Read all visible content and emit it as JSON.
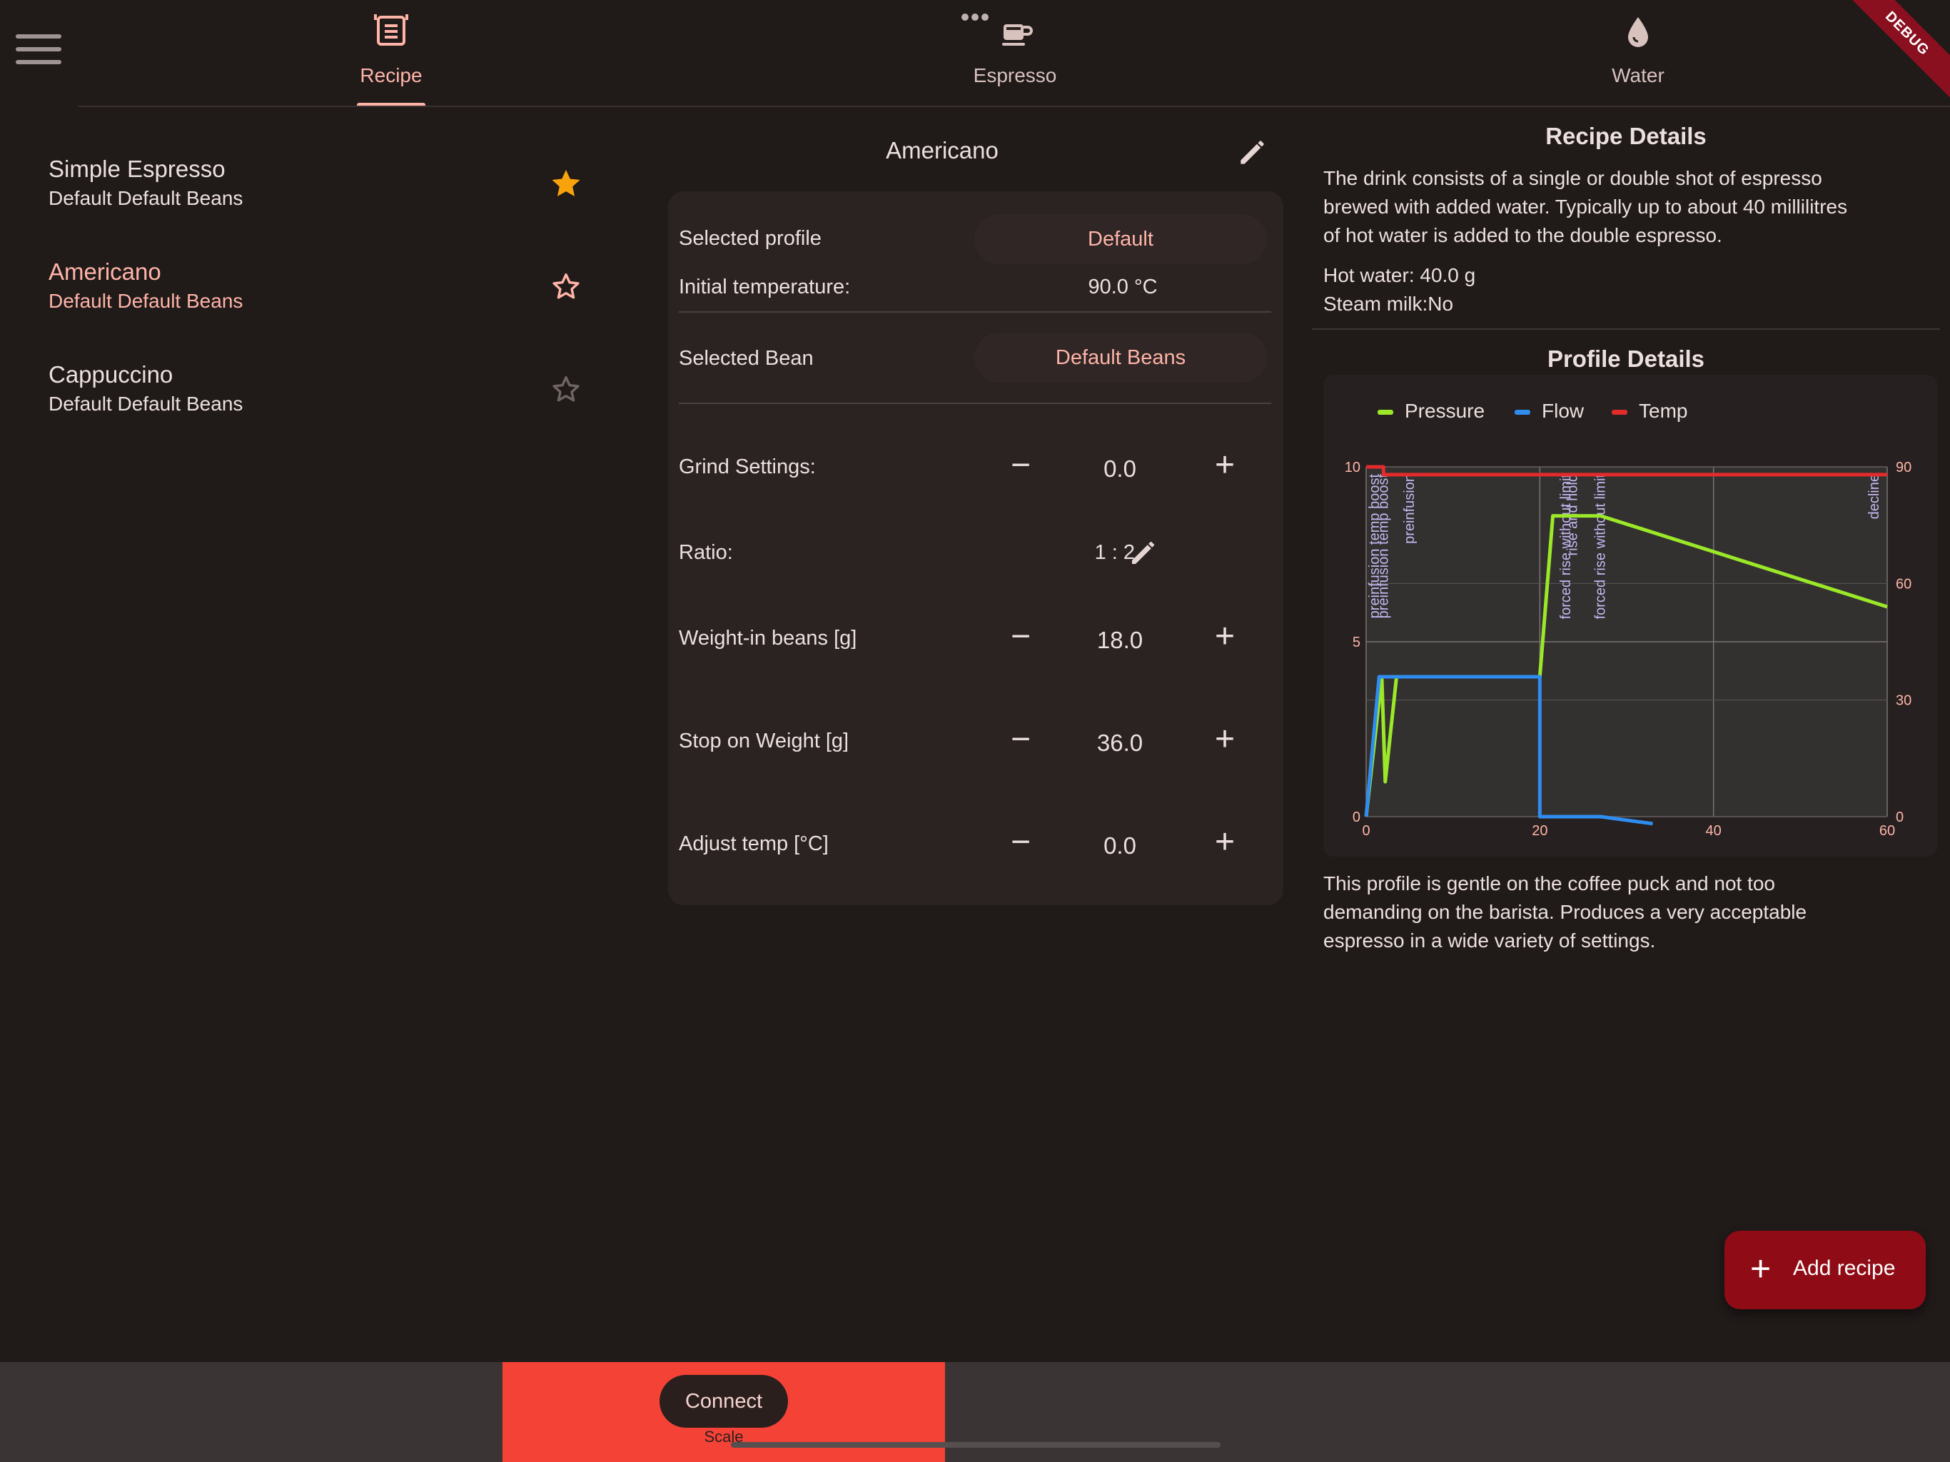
{
  "debug_badge": "DEBUG",
  "tabs": [
    {
      "label": "Recipe",
      "icon": "recipe-icon",
      "active": true
    },
    {
      "label": "Espresso",
      "icon": "coffee-cup-icon",
      "active": false
    },
    {
      "label": "Water",
      "icon": "water-drop-icon",
      "active": false
    }
  ],
  "recipes": [
    {
      "name": "Simple Espresso",
      "beans": "Default Default Beans",
      "favorite": true,
      "selected": false
    },
    {
      "name": "Americano",
      "beans": "Default Default Beans",
      "favorite": false,
      "selected": true
    },
    {
      "name": "Cappuccino",
      "beans": "Default Default Beans",
      "favorite": false,
      "selected": false
    }
  ],
  "detail": {
    "title": "Americano",
    "selected_profile_label": "Selected profile",
    "selected_profile_value": "Default",
    "initial_temp_label": "Initial temperature:",
    "initial_temp_value": "90.0 °C",
    "selected_bean_label": "Selected Bean",
    "selected_bean_value": "Default Beans",
    "grind_label": "Grind Settings:",
    "grind_value": "0.0",
    "ratio_label": "Ratio:",
    "ratio_value": "1 : 2",
    "weight_in_label": "Weight-in beans [g]",
    "weight_in_value": "18.0",
    "stop_weight_label": "Stop on Weight [g]",
    "stop_weight_value": "36.0",
    "adjust_temp_label": "Adjust temp [°C]",
    "adjust_temp_value": "0.0"
  },
  "recipe_details": {
    "heading": "Recipe Details",
    "description_lines": [
      "The drink consists of a single or double shot of espresso",
      "brewed with added water. Typically up to about 40 millilitres",
      "of hot water is added to the double espresso."
    ],
    "hot_water": "Hot water: 40.0 g",
    "steam_milk": "Steam milk:No"
  },
  "profile_details": {
    "heading": "Profile Details",
    "description_lines": [
      "This profile is gentle on the coffee puck and not too",
      "demanding on the barista.  Produces a very acceptable",
      "espresso in a wide variety of settings."
    ]
  },
  "colors": {
    "pressure": "#9be829",
    "flow": "#2f8df0",
    "temp": "#e32b2b",
    "accent": "#ffb4a8",
    "fab": "#8f0c16",
    "scale_panel": "#f44336"
  },
  "chart_data": {
    "type": "line",
    "legend": [
      "Pressure",
      "Flow",
      "Temp"
    ],
    "legend_position": "top-left",
    "grid": true,
    "xlim": [
      0,
      60
    ],
    "x_ticks": [
      "0",
      "20",
      "40",
      "60"
    ],
    "y_left_lim": [
      0,
      10
    ],
    "y_left_ticks": [
      "0",
      "5",
      "10"
    ],
    "y_right_lim": [
      0,
      90
    ],
    "y_right_ticks": [
      "0",
      "30",
      "60",
      "90"
    ],
    "series": [
      {
        "name": "Pressure",
        "axis": "left",
        "x": [
          0,
          1.8,
          2.2,
          3.5,
          20,
          21.5,
          27,
          60
        ],
        "y": [
          0,
          4,
          1,
          4,
          4,
          8.6,
          8.6,
          6
        ]
      },
      {
        "name": "Flow",
        "axis": "left",
        "x": [
          0,
          1.5,
          20,
          20,
          27,
          33
        ],
        "y": [
          0,
          4,
          4,
          0,
          0,
          -0.2
        ]
      },
      {
        "name": "Temp",
        "axis": "right",
        "x": [
          0,
          2,
          2,
          60
        ],
        "y": [
          90,
          90,
          88,
          88
        ]
      }
    ],
    "annotations": [
      {
        "x": 1,
        "text": "preinfusion temp boost"
      },
      {
        "x": 2,
        "text": "preinfusion temp boost"
      },
      {
        "x": 5,
        "text": "preinfusion"
      },
      {
        "x": 23,
        "text": "forced rise without limit"
      },
      {
        "x": 23.8,
        "text": "rise and hold"
      },
      {
        "x": 27,
        "text": "forced rise without limit"
      },
      {
        "x": 58.5,
        "text": "decline"
      }
    ]
  },
  "fab_label": "Add recipe",
  "bottom": {
    "connect_label": "Connect",
    "scale_label": "Scale"
  }
}
